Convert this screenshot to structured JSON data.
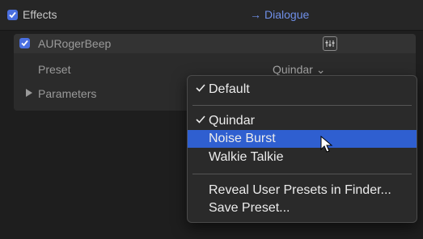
{
  "effects": {
    "label": "Effects",
    "role_arrow": "→",
    "role": "Dialogue"
  },
  "plugin": {
    "name": "AURogerBeep",
    "preset_label": "Preset",
    "preset_value": "Quindar ⌄",
    "parameters_label": "Parameters"
  },
  "menu": {
    "items": [
      {
        "label": "Default",
        "checked": true
      },
      {
        "label": "Quindar",
        "checked": true
      },
      {
        "label": "Noise Burst",
        "checked": false,
        "highlighted": true
      },
      {
        "label": "Walkie Talkie",
        "checked": false
      },
      {
        "label": "Reveal User Presets in Finder...",
        "checked": false
      },
      {
        "label": "Save Preset...",
        "checked": false
      }
    ]
  },
  "colors": {
    "accent": "#4a6fe0",
    "highlight": "#2f5fd0",
    "role": "#6f8fe8"
  }
}
